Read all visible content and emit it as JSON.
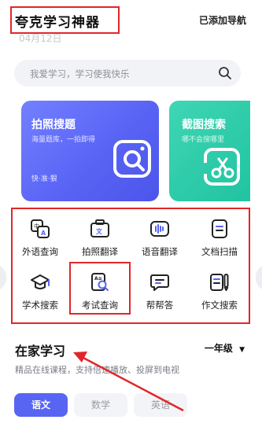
{
  "header": {
    "title": "夸克学习神器",
    "date": "04月12日",
    "added_nav": "已添加导航"
  },
  "search": {
    "placeholder": "我爱学习，学习使我快乐"
  },
  "cards": {
    "photo_search": {
      "title": "拍照搜题",
      "subtitle": "海量题库，一拍即得",
      "tag": "快·准·狠",
      "icon": "camera-scan-icon"
    },
    "screenshot_search": {
      "title": "截图搜索",
      "subtitle": "哪不会搜哪里",
      "icon": "scissors-icon"
    }
  },
  "tools": [
    {
      "label": "外语查询",
      "icon": "translate-icon"
    },
    {
      "label": "拍照翻译",
      "icon": "camera-translate-icon"
    },
    {
      "label": "语音翻译",
      "icon": "voice-wave-icon"
    },
    {
      "label": "文档扫描",
      "icon": "document-scan-icon"
    },
    {
      "label": "学术搜索",
      "icon": "graduation-cap-icon"
    },
    {
      "label": "考试查询",
      "icon": "exam-search-icon"
    },
    {
      "label": "帮帮答",
      "icon": "chat-bubble-icon"
    },
    {
      "label": "作文搜索",
      "icon": "essay-pen-icon"
    }
  ],
  "section": {
    "title": "在家学习",
    "grade": "一年级",
    "subtitle": "精品在线课程，支持倍速播放、投屏到电视"
  },
  "tabs": [
    "语文",
    "数学",
    "英语"
  ],
  "colors": {
    "accent": "#5865f2",
    "annotation_red": "#e0262a",
    "teal": "#21c3a1"
  }
}
